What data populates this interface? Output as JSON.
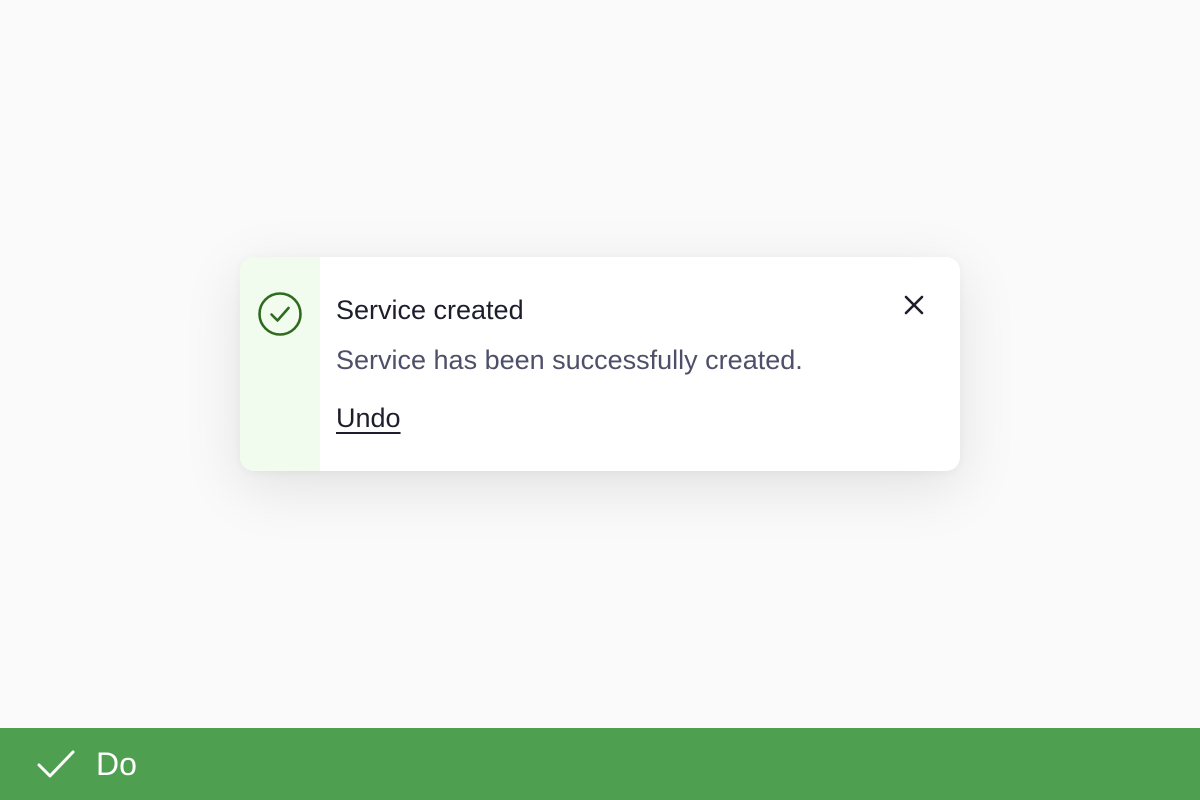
{
  "toast": {
    "title": "Service created",
    "message": "Service has been successfully created.",
    "action_label": "Undo",
    "status_icon": "success-check-circle-icon",
    "close_icon": "close-icon"
  },
  "footer": {
    "label": "Do",
    "icon": "check-icon"
  },
  "colors": {
    "page_background": "#fafafa",
    "toast_background": "#ffffff",
    "rail_background": "#f1fbee",
    "success_green": "#2f6b1f",
    "title_text": "#1d1d2c",
    "message_text": "#4e4f68",
    "footer_background": "#4ea050"
  }
}
